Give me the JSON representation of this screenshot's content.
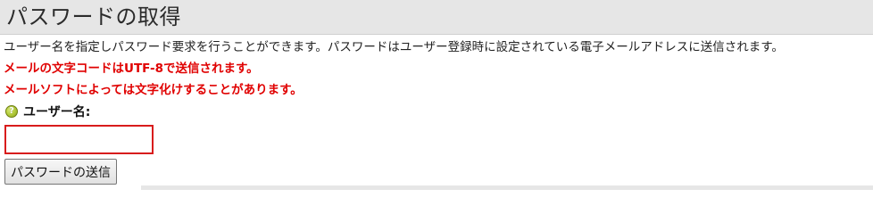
{
  "header": {
    "title": "パスワードの取得"
  },
  "content": {
    "description": "ユーザー名を指定しパスワード要求を行うことができます。パスワードはユーザー登録時に設定されている電子メールアドレスに送信されます。",
    "warning_encoding": "メールの文字コードはUTF-8で送信されます。",
    "warning_mojibake": "メールソフトによっては文字化けすることがあります。"
  },
  "form": {
    "help_icon": "question-icon",
    "username_label": "ユーザー名:",
    "username_value": "",
    "submit_label": "パスワードの送信"
  },
  "colors": {
    "warning": "#e00000",
    "input_border": "#d81c1c",
    "title_bar": "#e6e6e6"
  }
}
